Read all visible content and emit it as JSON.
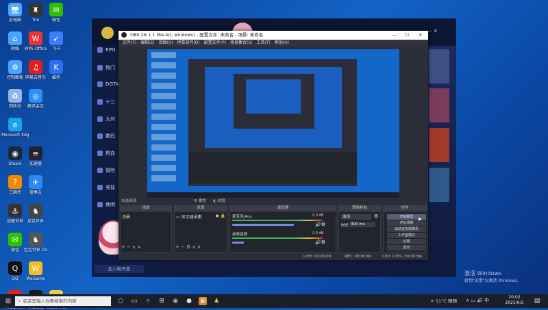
{
  "desktop": {
    "icons": [
      {
        "label": "此电脑",
        "icon": "computer-icon",
        "col": 0,
        "row": 0,
        "color": "#4aa3ff",
        "glyph": "🖥"
      },
      {
        "label": "Tim",
        "icon": "game-icon",
        "col": 1,
        "row": 0,
        "color": "#333",
        "glyph": "♜"
      },
      {
        "label": "微信",
        "icon": "wechat-icon",
        "col": 2,
        "row": 0,
        "color": "#2dc100",
        "glyph": "✉"
      },
      {
        "label": "网络",
        "icon": "network-icon",
        "col": 0,
        "row": 1,
        "color": "#4aa3ff",
        "glyph": "⌂"
      },
      {
        "label": "WPS Office",
        "icon": "wps-icon",
        "col": 1,
        "row": 1,
        "color": "#e33",
        "glyph": "W"
      },
      {
        "label": "飞书",
        "icon": "feishu-icon",
        "col": 2,
        "row": 1,
        "color": "#3b7cff",
        "glyph": "➹"
      },
      {
        "label": "控制面板",
        "icon": "control-panel-icon",
        "col": 0,
        "row": 2,
        "color": "#4aa3ff",
        "glyph": "⚙"
      },
      {
        "label": "网易云音乐",
        "icon": "music-icon",
        "col": 1,
        "row": 2,
        "color": "#e02020",
        "glyph": "♫"
      },
      {
        "label": "酷狗",
        "icon": "kugou-icon",
        "col": 2,
        "row": 2,
        "color": "#2b6ff0",
        "glyph": "K"
      },
      {
        "label": "回收站",
        "icon": "recycle-bin-icon",
        "col": 0,
        "row": 3,
        "color": "#8fb6e6",
        "glyph": "♻"
      },
      {
        "label": "腾讯会议",
        "icon": "meeting-icon",
        "col": 1,
        "row": 3,
        "color": "#2d8cff",
        "glyph": "◎"
      },
      {
        "label": "Microsoft Edge",
        "icon": "edge-icon",
        "col": 0,
        "row": 4,
        "color": "#1fa0e8",
        "glyph": "e"
      },
      {
        "label": "Steam",
        "icon": "steam-icon",
        "col": 0,
        "row": 5,
        "color": "#1b2838",
        "glyph": "◉"
      },
      {
        "label": "加速器",
        "icon": "accelerator-icon",
        "col": 1,
        "row": 5,
        "color": "#223",
        "glyph": "≡"
      },
      {
        "label": "三国杀",
        "icon": "game-icon-2",
        "col": 0,
        "row": 6,
        "color": "#f08a00",
        "glyph": "?"
      },
      {
        "label": "蓝奏云",
        "icon": "cloud-icon",
        "col": 1,
        "row": 6,
        "color": "#2b88f0",
        "glyph": "✈"
      },
      {
        "label": "战舰世界",
        "icon": "warship-icon",
        "col": 0,
        "row": 7,
        "color": "#333",
        "glyph": "⚓"
      },
      {
        "label": "坦克世界",
        "icon": "tank-icon",
        "col": 1,
        "row": 7,
        "color": "#444",
        "glyph": "♞"
      },
      {
        "label": "微信",
        "icon": "wechat-icon-2",
        "col": 0,
        "row": 8,
        "color": "#2dc100",
        "glyph": "✉"
      },
      {
        "label": "坦克世界 CN",
        "icon": "tank-icon-2",
        "col": 1,
        "row": 8,
        "color": "#555",
        "glyph": "♞"
      },
      {
        "label": "QQ",
        "icon": "qq-icon",
        "col": 0,
        "row": 9,
        "color": "#111",
        "glyph": "Q"
      },
      {
        "label": "WeGame",
        "icon": "wegame-icon",
        "col": 1,
        "row": 9,
        "color": "#f0c020",
        "glyph": "W"
      },
      {
        "label": "网易云音乐",
        "icon": "music-icon-2",
        "col": 0,
        "row": 10,
        "color": "#e02020",
        "glyph": "♫"
      },
      {
        "label": "英雄联盟",
        "icon": "lol-icon",
        "col": 1,
        "row": 10,
        "color": "#1a1a1a",
        "glyph": "L"
      },
      {
        "label": "新建文件夹",
        "icon": "folder-icon",
        "col": 2,
        "row": 10,
        "color": "#f2c94c",
        "glyph": "▭"
      }
    ]
  },
  "launcher": {
    "nav": [
      "RPG",
      "热门",
      "DOTA",
      "十二",
      "九州",
      "数码",
      "热血",
      "冒险",
      "竞技",
      "休闲"
    ],
    "footer_button": "加入聊天室"
  },
  "obs": {
    "title": "OBS 26.1.1 (64-bit, windows) - 配置文件: 未命名 - 场景: 未命名",
    "menu": [
      "文件(F)",
      "编辑(E)",
      "视图(V)",
      "停靠部件(D)",
      "配置文件(P)",
      "场景集合(S)",
      "工具(T)",
      "帮助(H)"
    ],
    "source_bar": {
      "label": "未选择源",
      "props": "属性",
      "filters": "滤镜"
    },
    "panels": {
      "scenes": {
        "title": "场景",
        "items": [
          "场景"
        ]
      },
      "sources": {
        "title": "来源",
        "items": [
          "显示器采集"
        ]
      },
      "mixer": {
        "title": "混音器",
        "tracks": [
          {
            "name": "麦克风/Aux",
            "db": "0.0 dB",
            "level": 0.8
          },
          {
            "name": "桌面音频",
            "db": "0.0 dB",
            "level": 0.15
          }
        ]
      },
      "transitions": {
        "title": "转场特效",
        "type": "淡出",
        "duration_label": "时长",
        "duration": "300 ms"
      },
      "controls": {
        "title": "控件",
        "buttons": [
          "开始推流",
          "开始录制",
          "启动虚拟摄像机",
          "工作室模式",
          "设置",
          "退出"
        ]
      }
    },
    "status": {
      "live": "LIVE: 00:00:00",
      "rec": "REC: 00:00:00",
      "cpu": "CPU: 0.9%, 30.00 fps"
    }
  },
  "watermark": {
    "line1": "激活 Windows",
    "line2": "转到\"设置\"以激活 Windows。"
  },
  "taskbar": {
    "search_placeholder": "在这里输入你要搜索的内容",
    "weather": "11°C 晴朗",
    "time": "20:02",
    "date": "2021/6/3"
  }
}
